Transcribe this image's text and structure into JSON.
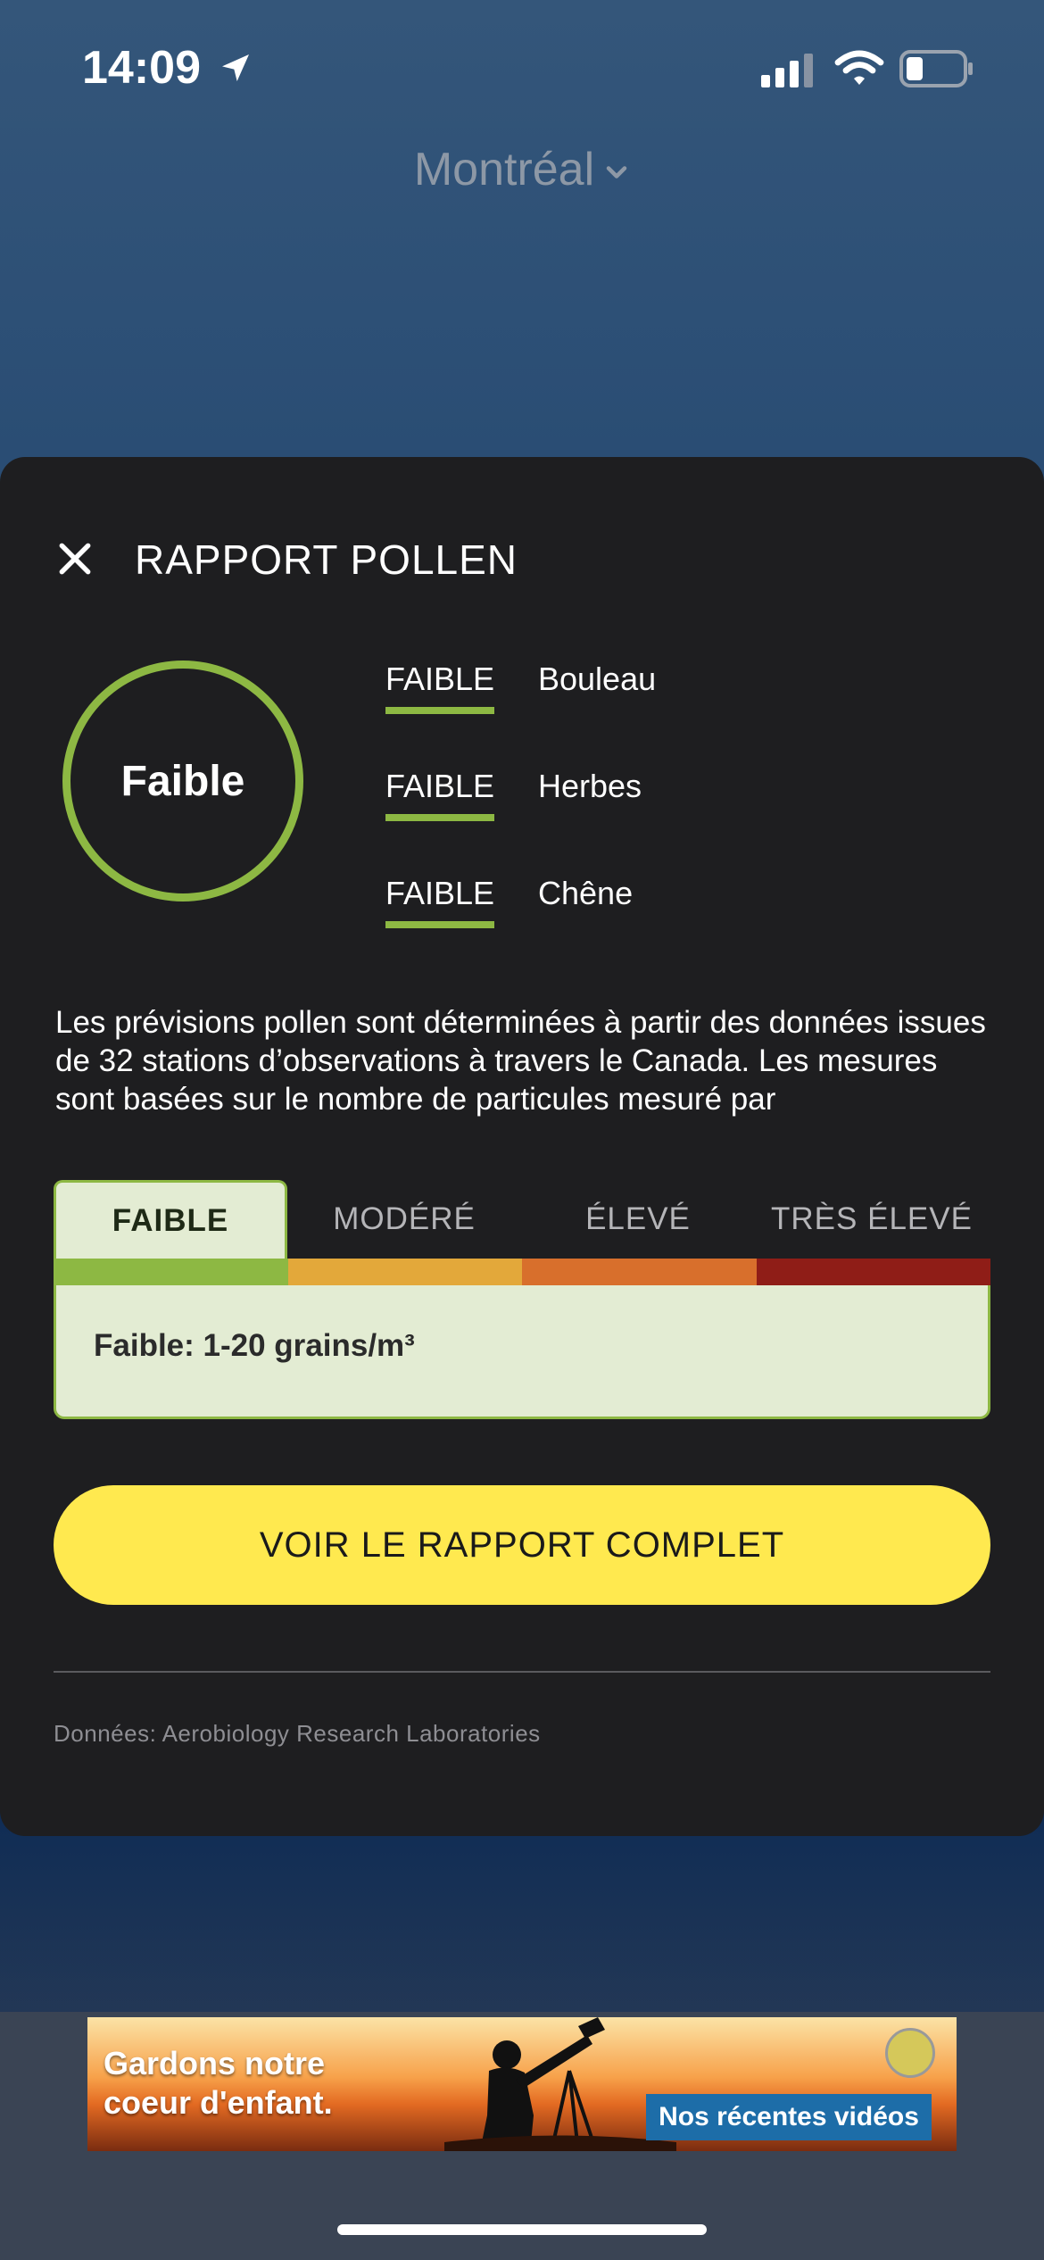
{
  "status_bar": {
    "time": "14:09"
  },
  "header": {
    "city": "Montréal"
  },
  "sheet": {
    "title": "RAPPORT POLLEN",
    "overall_level": "Faible",
    "pollen": [
      {
        "level": "FAIBLE",
        "name": "Bouleau"
      },
      {
        "level": "FAIBLE",
        "name": "Herbes"
      },
      {
        "level": "FAIBLE",
        "name": "Chêne"
      }
    ],
    "description": "Les prévisions pollen sont déterminées à partir des données issues de 32 stations d’observations à travers le Canada. Les mesures sont basées sur le nombre de particules mesuré par",
    "scale": {
      "tabs": [
        "FAIBLE",
        "MODÉRÉ",
        "ÉLEVÉ",
        "TRÈS ÉLEVÉ"
      ],
      "colors": [
        "#8db843",
        "#e3a83a",
        "#d86f2c",
        "#8f1d17"
      ],
      "active_tab": 0,
      "detail": "Faible: 1-20 grains/m³"
    },
    "cta_label": "VOIR LE RAPPORT COMPLET",
    "source": "Données: Aerobiology Research Laboratories"
  },
  "ad": {
    "headline_line1": "Gardons notre",
    "headline_line2": "coeur d'enfant.",
    "button_label": "Nos récentes vidéos"
  },
  "colors": {
    "accent_green": "#8db843",
    "cta_yellow": "#ffe94f",
    "sheet_bg": "#1e1e20"
  }
}
